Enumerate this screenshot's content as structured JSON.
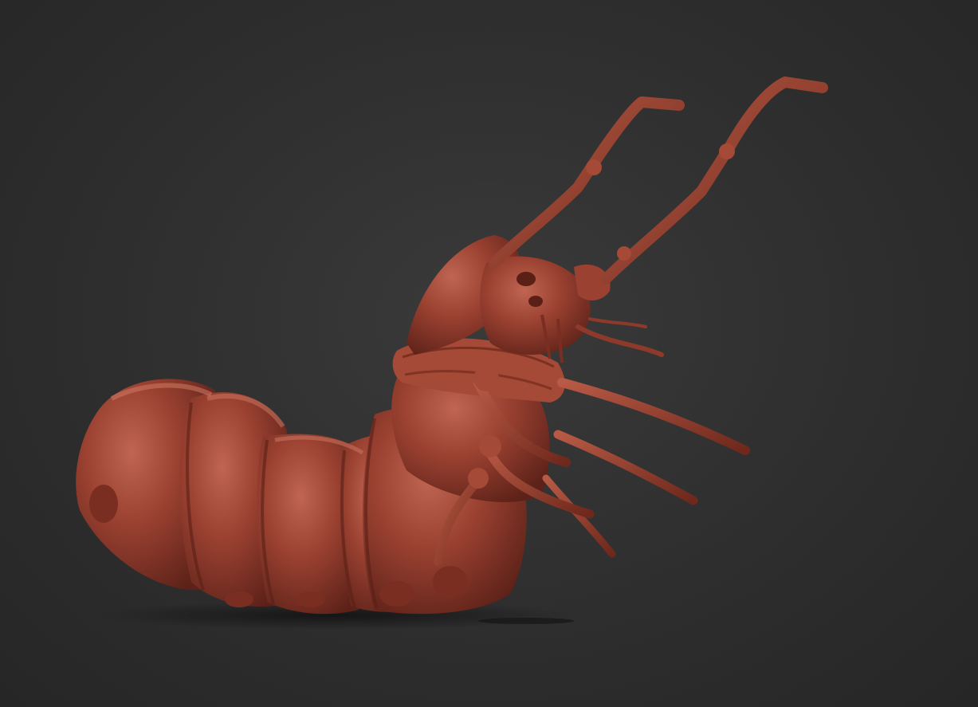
{
  "scene": {
    "subject_icon": "larva-sculpt-icon",
    "colors": {
      "background": "#2e2e2e",
      "clay_base": "#8e3a2a",
      "clay_light": "#b85a45",
      "clay_dark": "#5a1f15",
      "shadow": "#1a1a1a"
    }
  }
}
